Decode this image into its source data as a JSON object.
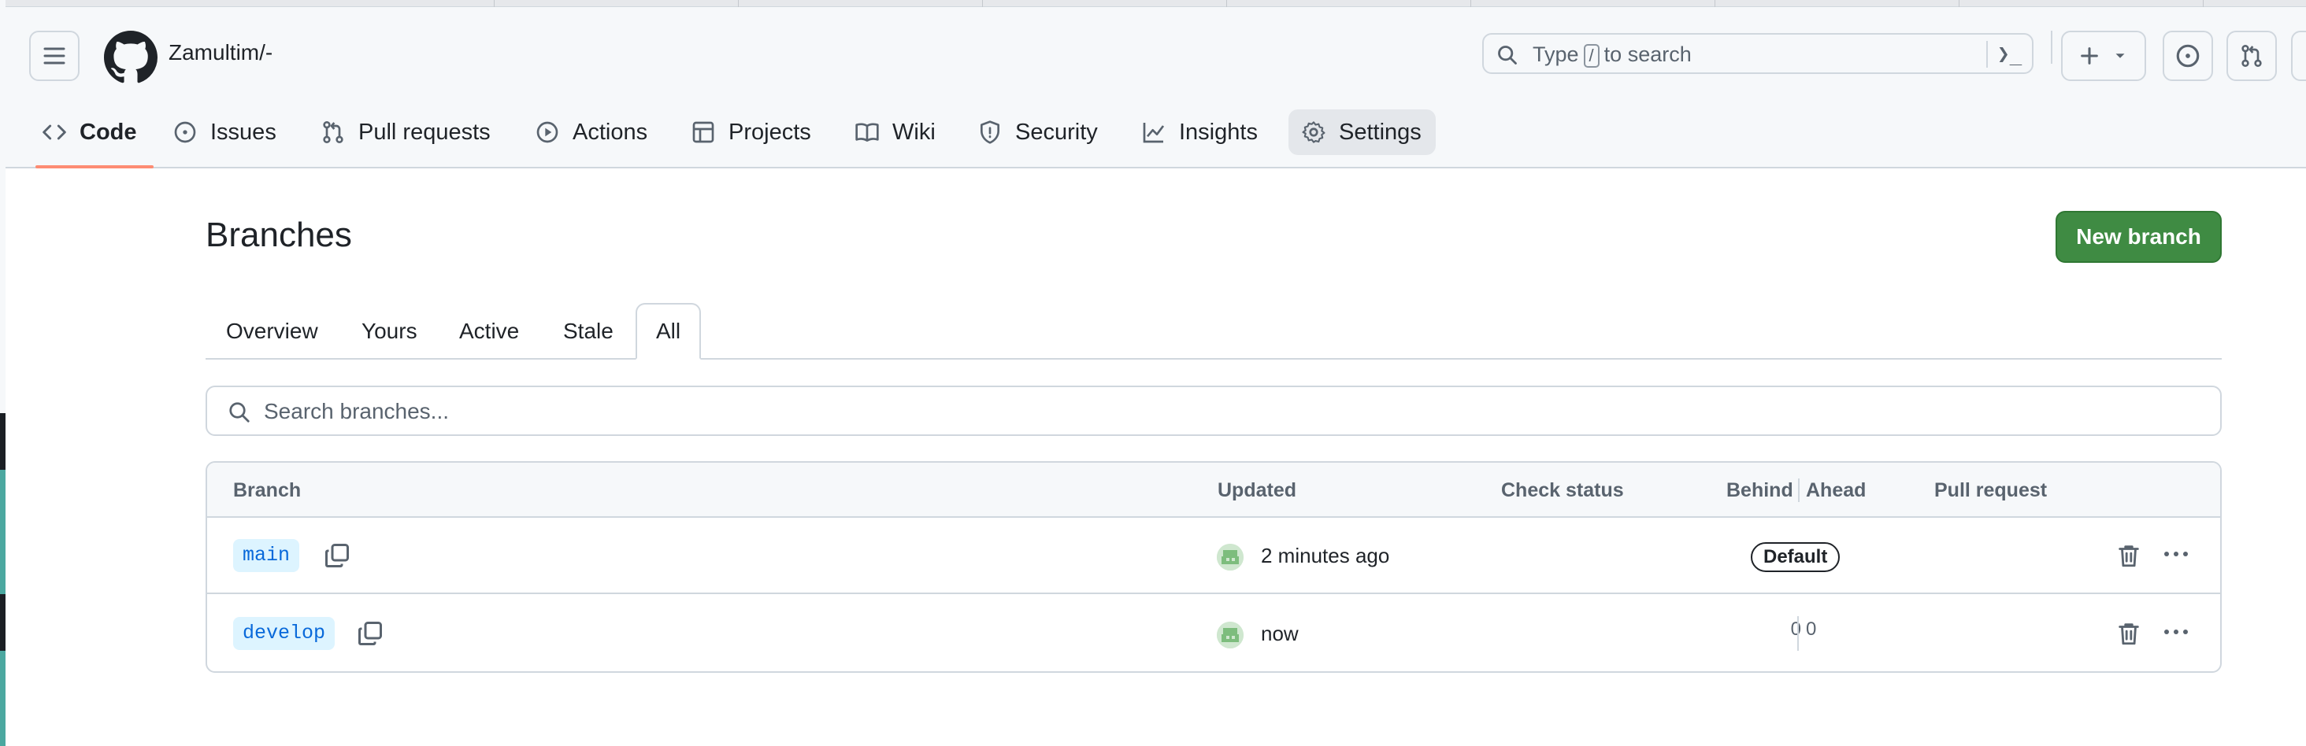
{
  "header": {
    "repo_name": "Zamultim/-",
    "search_prefix": "Type",
    "search_key": "/",
    "search_suffix": "to search",
    "command_glyph": "❯_"
  },
  "nav": {
    "code": "Code",
    "issues": "Issues",
    "pull_requests": "Pull requests",
    "actions": "Actions",
    "projects": "Projects",
    "wiki": "Wiki",
    "security": "Security",
    "insights": "Insights",
    "settings": "Settings"
  },
  "page": {
    "title": "Branches",
    "new_branch_label": "New branch",
    "tabs": [
      "Overview",
      "Yours",
      "Active",
      "Stale",
      "All"
    ],
    "active_tab": "All",
    "search_placeholder": "Search branches..."
  },
  "table": {
    "headers": {
      "branch": "Branch",
      "updated": "Updated",
      "check_status": "Check status",
      "behind": "Behind",
      "ahead": "Ahead",
      "pull_request": "Pull request"
    },
    "rows": [
      {
        "name": "main",
        "updated": "2 minutes ago",
        "badge": "Default"
      },
      {
        "name": "develop",
        "updated": "now",
        "behind": "0",
        "ahead": "0"
      }
    ]
  },
  "colors": {
    "accent_underline": "#fd8c73",
    "primary_button": "#3f8b43",
    "branch_chip_bg": "#ddf4ff",
    "branch_chip_text": "#0969da"
  }
}
